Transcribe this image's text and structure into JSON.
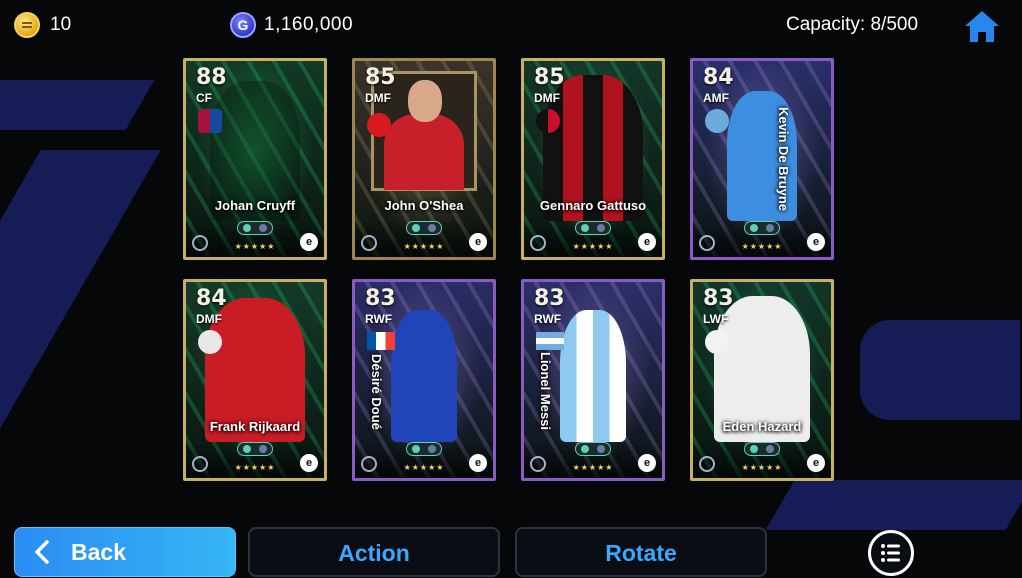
{
  "header": {
    "coins_value": "10",
    "gp_symbol": "G",
    "gp_value": "1,160,000",
    "capacity": "Capacity: 8/500"
  },
  "cards": [
    {
      "rating": "88",
      "position": "CF",
      "name": "Johan Cruyff",
      "style": "gold",
      "bg": "#123a26",
      "accent": "#2cf57c"
    },
    {
      "rating": "85",
      "position": "DMF",
      "name": "John O'Shea",
      "style": "gold-dark",
      "bg": "#3a332a",
      "accent": "#c9b47a"
    },
    {
      "rating": "85",
      "position": "DMF",
      "name": "Gennaro Gattuso",
      "style": "gold",
      "bg": "#143628",
      "accent": "#2cf57c"
    },
    {
      "rating": "84",
      "position": "AMF",
      "name": "Kevin De Bruyne",
      "style": "purple",
      "bg": "#2a2f6a",
      "accent": "#c6a2ff"
    },
    {
      "rating": "84",
      "position": "DMF",
      "name": "Frank Rijkaard",
      "style": "gold",
      "bg": "#143a28",
      "accent": "#2cf57c"
    },
    {
      "rating": "83",
      "position": "RWF",
      "name": "Désiré Doué",
      "style": "purple",
      "bg": "#2a2d66",
      "accent": "#c6a2ff"
    },
    {
      "rating": "83",
      "position": "RWF",
      "name": "Lionel Messi",
      "style": "purple",
      "bg": "#2c2f6a",
      "accent": "#c6a2ff"
    },
    {
      "rating": "83",
      "position": "LWF",
      "name": "Eden Hazard",
      "style": "gold",
      "bg": "#12362a",
      "accent": "#2cf57c"
    }
  ],
  "buttons": {
    "back": "Back",
    "action": "Action",
    "rotate": "Rotate"
  },
  "colors": {
    "accent_blue": "#3aa8ff",
    "background": "#060709",
    "stripe": "#1b2470"
  },
  "icons": {
    "coin": "coin-icon",
    "gp": "gp-icon",
    "home": "home-icon",
    "back": "chevron-left-icon",
    "menu": "list-menu-icon"
  }
}
